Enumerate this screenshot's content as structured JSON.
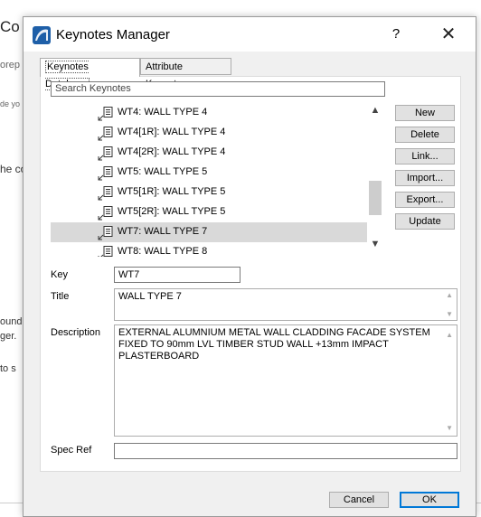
{
  "background": {
    "fragments": [
      "Co",
      "orep",
      "de yo",
      "he co",
      "ound",
      "ger.",
      "to s"
    ]
  },
  "dialog": {
    "title": "Keynotes Manager",
    "help_label": "?",
    "close_label": "✕",
    "tabs": [
      {
        "label": "Keynotes Database",
        "active": true
      },
      {
        "label": "Attribute Keynotes",
        "active": false
      }
    ],
    "search": {
      "placeholder": "Search Keynotes",
      "value": ""
    },
    "keynotes": [
      {
        "label": "WT4: WALL TYPE 4",
        "selected": false
      },
      {
        "label": "WT4[1R]: WALL TYPE 4",
        "selected": false
      },
      {
        "label": "WT4[2R]: WALL TYPE 4",
        "selected": false
      },
      {
        "label": "WT5: WALL TYPE 5",
        "selected": false
      },
      {
        "label": "WT5[1R]: WALL TYPE 5",
        "selected": false
      },
      {
        "label": "WT5[2R]: WALL TYPE 5",
        "selected": false
      },
      {
        "label": "WT7: WALL TYPE 7",
        "selected": true
      },
      {
        "label": "WT8: WALL TYPE 8",
        "selected": false
      }
    ],
    "buttons": {
      "new": "New",
      "delete": "Delete",
      "link": "Link...",
      "import": "Import...",
      "export": "Export...",
      "update": "Update"
    },
    "fields": {
      "key_label": "Key",
      "key_value": "WT7",
      "title_label": "Title",
      "title_value": "WALL TYPE 7",
      "description_label": "Description",
      "description_value": "EXTERNAL ALUMNIUM METAL WALL CLADDING FACADE SYSTEM FIXED TO 90mm LVL TIMBER STUD WALL +13mm  IMPACT PLASTERBOARD",
      "spec_ref_label": "Spec Ref",
      "spec_ref_value": ""
    },
    "footer": {
      "cancel": "Cancel",
      "ok": "OK"
    },
    "colors": {
      "accent": "#0078d7",
      "selected_row": "#d9d9d9",
      "app_icon": "#1e5fa8"
    }
  }
}
